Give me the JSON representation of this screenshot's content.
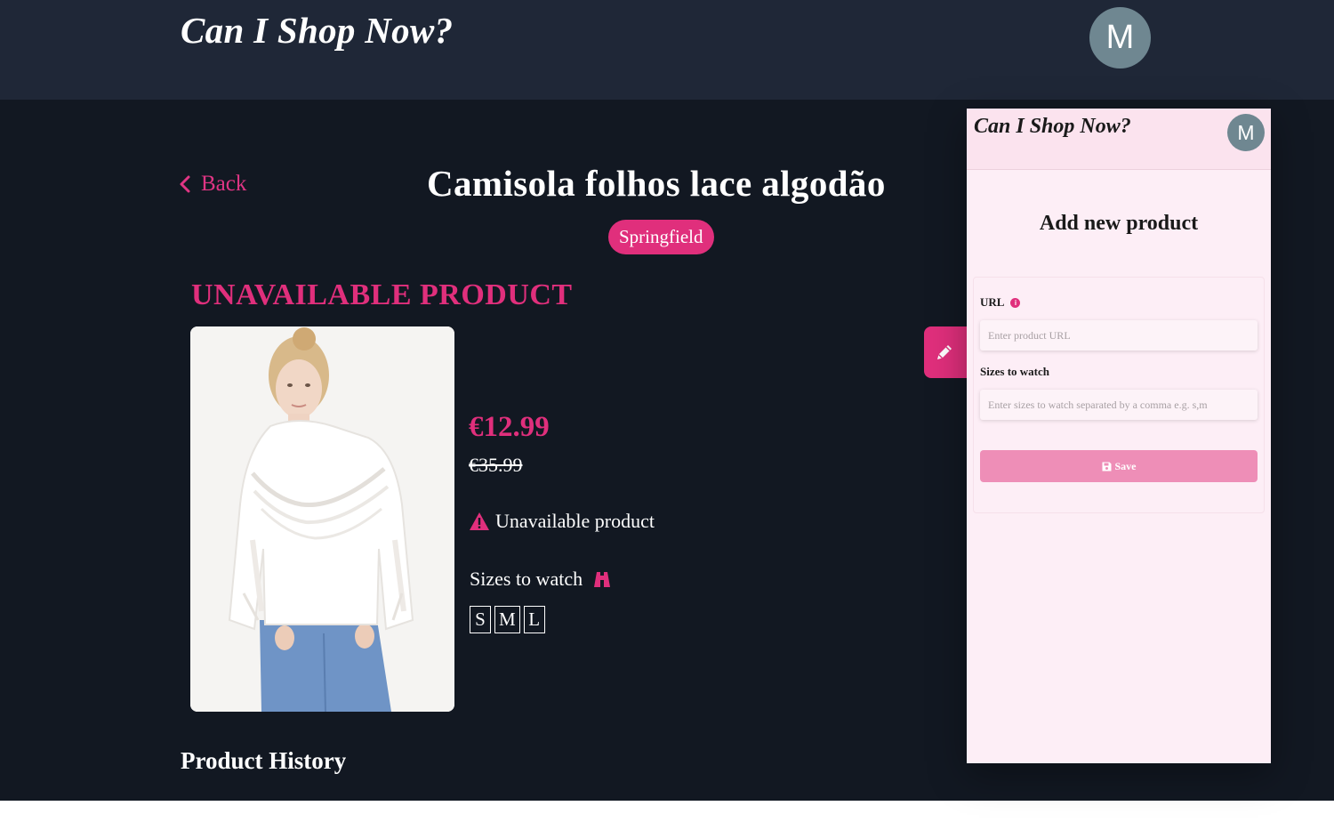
{
  "header": {
    "brand": "Can I Shop Now?",
    "avatar_initial": "M"
  },
  "product": {
    "back_label": "Back",
    "title": "Camisola folhos lace algodão",
    "store": "Springfield",
    "availability_heading": "UNAVAILABLE PRODUCT",
    "price": "€12.99",
    "original_price": "€35.99",
    "status_text": "Unavailable product",
    "sizes_label": "Sizes to watch",
    "sizes": [
      "S",
      "M",
      "L"
    ],
    "history_title": "Product History"
  },
  "panel": {
    "brand": "Can I Shop Now?",
    "avatar_initial": "M",
    "title": "Add new product",
    "url_label": "URL",
    "url_info": "i",
    "url_placeholder": "Enter product URL",
    "sizes_label": "Sizes to watch",
    "sizes_placeholder": "Enter sizes to watch separated by a comma e.g. s,m",
    "save_label": "Save"
  },
  "colors": {
    "accent": "#e02f7c",
    "header_bg": "#1f2737",
    "page_bg": "#121822",
    "panel_bg": "#fdeef6",
    "save_button": "#ee8eb7"
  },
  "icons": {
    "back": "chevron-left-icon",
    "status": "warning-triangle-icon",
    "sizes": "binoculars-icon",
    "edit": "pencil-icon",
    "save": "floppy-disk-icon"
  }
}
